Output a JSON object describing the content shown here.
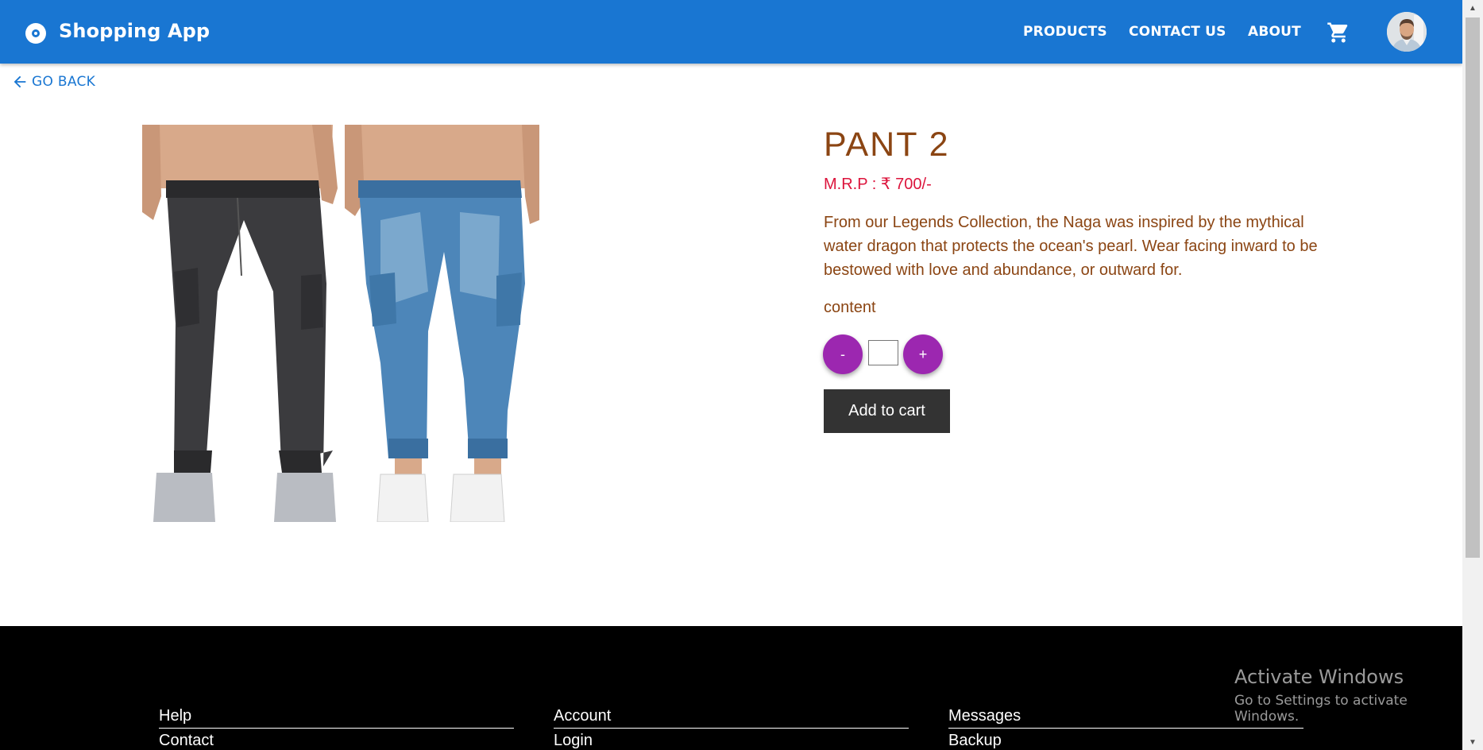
{
  "header": {
    "title": "Shopping App",
    "nav": [
      "PRODUCTS",
      "CONTACT US",
      "ABOUT"
    ]
  },
  "nav_back": {
    "label": "GO BACK"
  },
  "product": {
    "name": "PANT 2",
    "price": "M.R.P : ₹ 700/-",
    "description": "From our Legends Collection, the Naga was inspired by the mythical water dragon that protects the ocean's pearl. Wear facing inward to be bestowed with love and abundance, or outward for.",
    "content_label": "content",
    "quantity": "",
    "minus_label": "-",
    "plus_label": "+",
    "add_to_cart": "Add to cart"
  },
  "footer": {
    "columns": [
      {
        "heading": "Help",
        "link": "Contact"
      },
      {
        "heading": "Account",
        "link": "Login"
      },
      {
        "heading": "Messages",
        "link": "Backup"
      }
    ]
  },
  "watermark": {
    "line1": "Activate Windows",
    "line2": "Go to Settings to activate Windows."
  },
  "colors": {
    "appbar": "#1976d2",
    "title": "#8b4513",
    "price": "#dc143c",
    "qty_button": "#9c27b0",
    "add_to_cart": "#333333"
  },
  "icons": [
    "brand-icon",
    "cart-icon",
    "avatar",
    "arrow-back-icon",
    "product-image"
  ]
}
